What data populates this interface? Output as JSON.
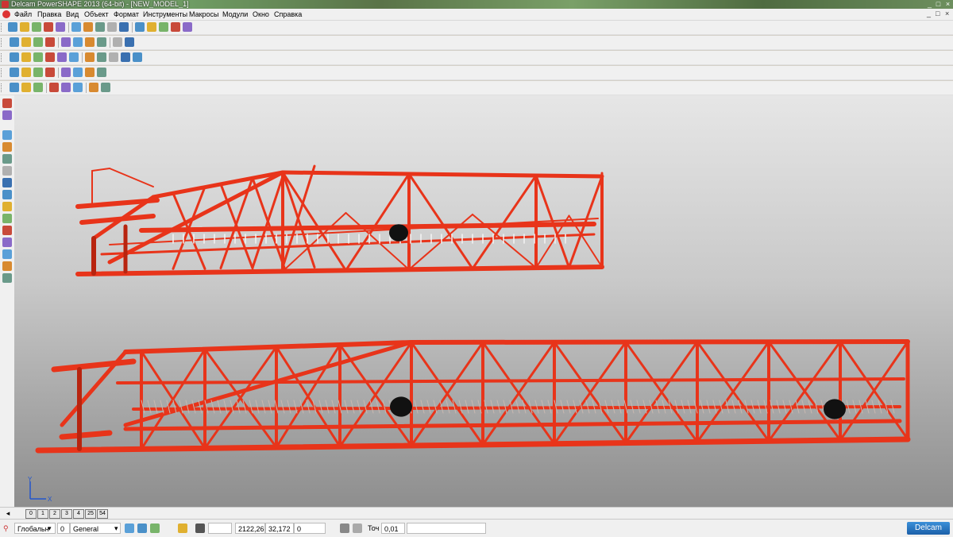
{
  "window": {
    "title": "Delcam PowerSHAPE 2013 (64-bit) - [NEW_MODEL_1]",
    "minimize": "_",
    "restore": "□",
    "close": "×"
  },
  "menu": {
    "items": [
      "Файл",
      "Правка",
      "Вид",
      "Объект",
      "Формат",
      "Инструменты",
      "Макросы",
      "Модули",
      "Окно",
      "Справка"
    ],
    "doc_controls": [
      "_",
      "□",
      "×"
    ]
  },
  "level_tabs": [
    "0",
    "1",
    "2",
    "3",
    "4",
    "25",
    "54"
  ],
  "status": {
    "level_combo": "Глобальн",
    "level_number": "0",
    "level_name": "General",
    "coord_x": "2122,26",
    "coord_y": "32,172",
    "coord_z": "0",
    "tolerance_label": "Точ",
    "tolerance_value": "0,01",
    "brand": "Delcam"
  },
  "axis": {
    "x_label": "X",
    "y_label": "Y"
  },
  "colors": {
    "structure": "#e8341a",
    "structure_dark": "#b8240f",
    "weight": "#111111",
    "viewport_top": "#e6e6e6",
    "viewport_bottom": "#8e8e8e",
    "axis_blue": "#2255cc"
  },
  "icons": {
    "main_toolbar": [
      "new-icon",
      "open-icon",
      "save-icon",
      "print-icon",
      "cut-icon",
      "copy-icon",
      "paste-icon",
      "delete-icon",
      "undo-icon",
      "redo-icon",
      "select-icon",
      "lasso-icon",
      "circle-select-icon",
      "shading-icon",
      "render-icon"
    ],
    "view_toolbar": [
      "view-iso-icon",
      "view-top-icon",
      "view-front-icon",
      "zoom-icon",
      "zoom-box-icon",
      "pan-icon",
      "rotate-icon",
      "shaded-icon",
      "light-icon",
      "hand-icon"
    ],
    "object_toolbar": [
      "calculator-icon",
      "file-icon",
      "model-icon",
      "surface-icon",
      "solid-icon",
      "play-icon",
      "box-icon",
      "align-icon",
      "info-icon",
      "ruler-icon",
      "transform-icon"
    ],
    "solid_toolbar": [
      "solid-edit-icon",
      "feature-icon",
      "boolean-icon",
      "fillet-icon",
      "chamfer-icon",
      "shell-icon",
      "extrude-icon",
      "cut-solid-icon"
    ],
    "misc_toolbar": [
      "measure-icon",
      "x-axis-icon",
      "fixture-icon",
      "assembly-icon",
      "part-icon",
      "camera-icon",
      "analysis-icon",
      "sheet-icon"
    ],
    "left_toolbar": [
      "pointer-icon",
      "workplane-icon",
      "line-icon",
      "arc-icon",
      "curve-icon",
      "text-icon",
      "dimension-icon",
      "surface-tool-icon",
      "solid-tool-icon",
      "mesh-icon",
      "electrode-icon",
      "wireframe-icon",
      "assembly-tool-icon",
      "drawing-icon",
      "detail-icon"
    ]
  }
}
